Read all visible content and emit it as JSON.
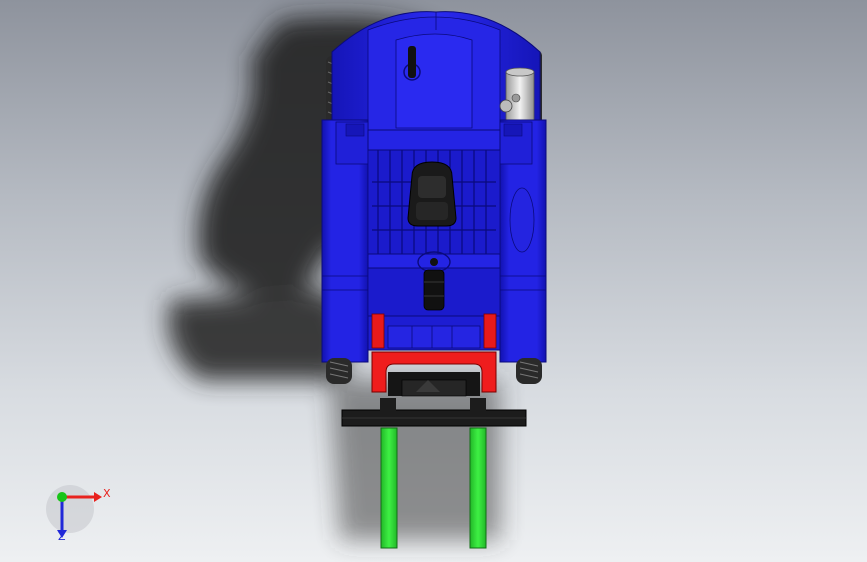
{
  "viewport": {
    "background_top": "#8e939d",
    "background_bottom": "#eef0f2"
  },
  "model": {
    "body_color": "#1f1fd6",
    "body_dark": "#0c0c8e",
    "counterweight_color": "#2727e0",
    "carriage_color": "#ef1d1d",
    "fork_color": "#35e63a",
    "tire_color": "#2a2a2a",
    "seat_color": "#1a1a1a",
    "exhaust_color": "#d4d4d4"
  },
  "triad": {
    "x_axis_label": "X",
    "z_axis_label": "Z",
    "x_color": "#e8221e",
    "y_color": "#18c418",
    "z_color": "#2028d8"
  }
}
